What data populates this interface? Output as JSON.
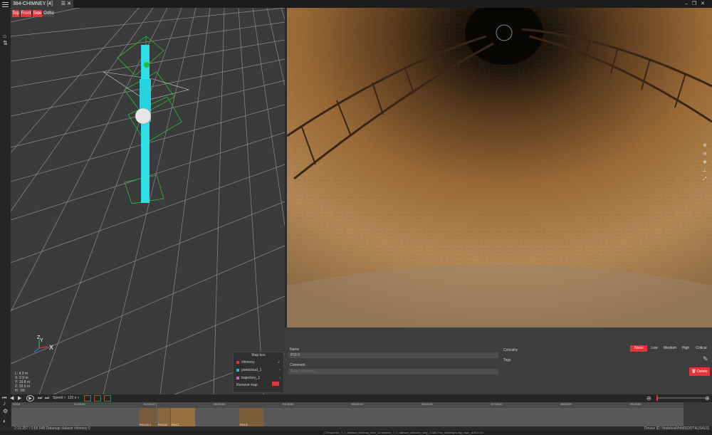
{
  "window": {
    "tab_title": "384-CHIMNEY [4]"
  },
  "view_buttons": [
    "Top",
    "Front",
    "Side",
    "Ortho"
  ],
  "coordinates": {
    "lines": [
      "L:  4.3 m",
      "X:  2.9 m",
      "Y:  10.8 m",
      "Z:  32.0 m",
      "H:  -90"
    ]
  },
  "map_box": {
    "title": "Map box",
    "layers": [
      {
        "name": "chimney",
        "color": "#e0363b"
      },
      {
        "name": "pointcloud_1",
        "color": "#2aa8d8"
      },
      {
        "name": "trajectory_1",
        "color": "#d85bd8"
      }
    ],
    "remove_label": "Remove map"
  },
  "playback": {
    "speed_label": "Speed",
    "speed_value": "120 x"
  },
  "timeline": {
    "ticks": [
      "00:00",
      "01:00:00",
      "02:00:00",
      "03:00:00",
      "04:00:00",
      "05:00:00",
      "06:00:00",
      "07:00:00",
      "08:00:00",
      "09:00:00"
    ],
    "thumbs": [
      "POI-02-1",
      "POI-01",
      "POI-1",
      "POI-3"
    ]
  },
  "properties": {
    "name_label": "Name",
    "name_value": "POI-0",
    "comment_label": "Comment",
    "comment_placeholder": "Enter comment...",
    "criticality_label": "Criticality",
    "criticality_options": [
      "None",
      "Low",
      "Medium",
      "High",
      "Critical"
    ],
    "tags_label": "Tags",
    "delete_label": "Delete"
  },
  "status": {
    "line1": "2:15.257 / 0:55.548     Datamap dataset   chimney   0",
    "line1_right": "Device ID:   NodeboxMobilSOOT4LIS4LIS",
    "line2": "C:\\Inspector_3_0_dataset_chimney_step_1\\Inspector_3_0_dataset_chimney_step_2\\384-Test_datamaps-mjp_num_d-00.LOG"
  },
  "colors": {
    "accent": "#e0363b",
    "pointcloud": "#2ee6ef",
    "trajectory": "#1fbf3a"
  }
}
